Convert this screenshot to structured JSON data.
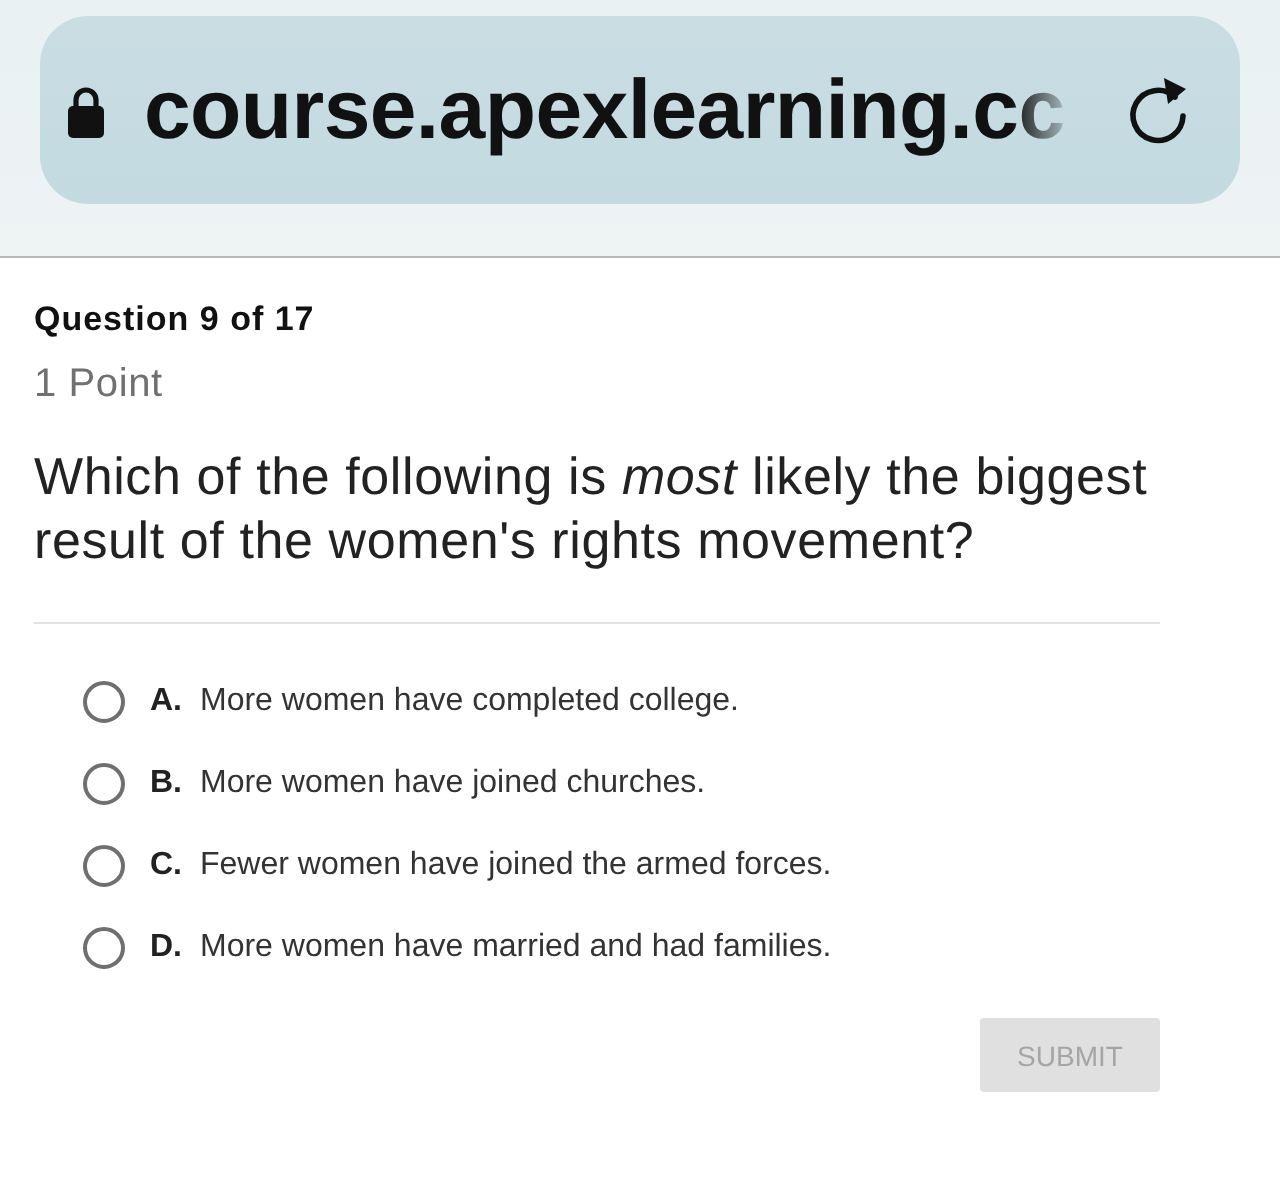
{
  "browser": {
    "url": "course.apexlearning.cc"
  },
  "question": {
    "number": "Question 9 of 17",
    "points": "1 Point",
    "prompt": "Which of the following is *most* likely the biggest result of the women's rights movement?"
  },
  "options": [
    {
      "letter": "A.",
      "text": "More women have completed college.",
      "selected": false
    },
    {
      "letter": "B.",
      "text": "More women have joined churches.",
      "selected": false
    },
    {
      "letter": "C.",
      "text": "Fewer women have joined the armed forces.",
      "selected": false
    },
    {
      "letter": "D.",
      "text": "More women have married and had families.",
      "selected": false
    }
  ],
  "submit": {
    "label": "SUBMIT",
    "disabled": true
  }
}
